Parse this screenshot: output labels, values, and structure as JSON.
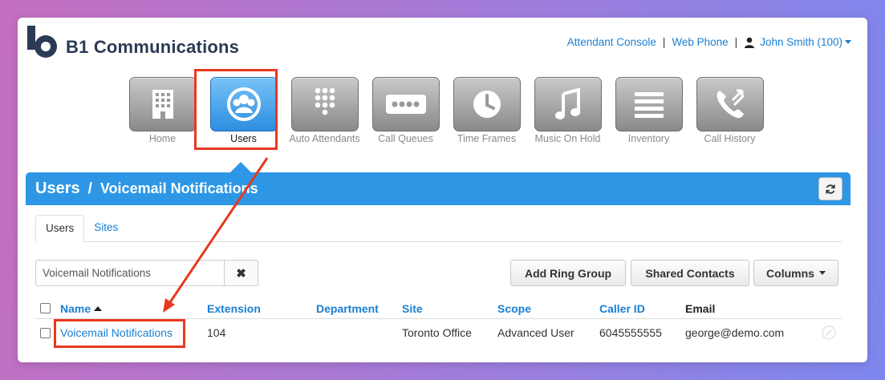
{
  "header": {
    "brand": "B1 Communications",
    "links": [
      "Attendant Console",
      "Web Phone"
    ],
    "user": "John Smith (100)"
  },
  "nav": [
    {
      "label": "Home",
      "icon": "building-icon"
    },
    {
      "label": "Users",
      "icon": "users-icon",
      "active": true
    },
    {
      "label": "Auto Attendants",
      "icon": "keypad-icon"
    },
    {
      "label": "Call Queues",
      "icon": "dots-icon"
    },
    {
      "label": "Time Frames",
      "icon": "clock-icon"
    },
    {
      "label": "Music On Hold",
      "icon": "music-note-icon"
    },
    {
      "label": "Inventory",
      "icon": "list-icon"
    },
    {
      "label": "Call History",
      "icon": "phone-history-icon"
    }
  ],
  "breadcrumb": {
    "section": "Users",
    "page": "Voicemail Notifications"
  },
  "tabs": [
    "Users",
    "Sites"
  ],
  "search": {
    "value": "Voicemail Notifications"
  },
  "buttons": {
    "add_ring_group": "Add Ring Group",
    "shared_contacts": "Shared Contacts",
    "columns": "Columns"
  },
  "table": {
    "headers": [
      "Name",
      "Extension",
      "Department",
      "Site",
      "Scope",
      "Caller ID",
      "Email"
    ],
    "rows": [
      {
        "name": "Voicemail Notifications",
        "extension": "104",
        "department": "",
        "site": "Toronto Office",
        "scope": "Advanced User",
        "caller_id": "6045555555",
        "email": "george@demo.com"
      }
    ]
  },
  "colors": {
    "accent": "#2d97e6",
    "link": "#1a7fd1",
    "annotation": "#e8391f"
  }
}
